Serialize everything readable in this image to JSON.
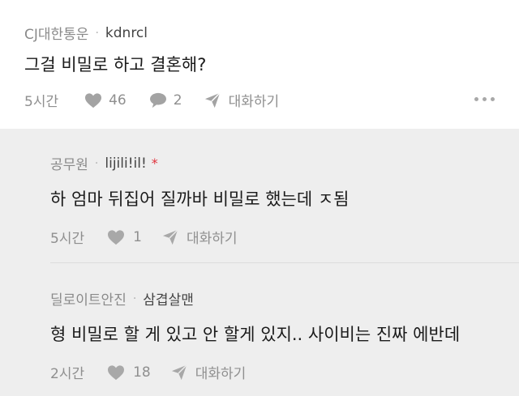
{
  "comment": {
    "brand": "CJ대한통운",
    "nickname": "kdnrcl",
    "text": "그걸 비밀로 하고 결혼해?",
    "time": "5시간",
    "likes": "46",
    "replies": "2",
    "reply_label": "대화하기"
  },
  "replies": [
    {
      "brand": "공무원",
      "nickname": "lijili!il!",
      "star": "*",
      "text": "하 엄마 뒤집어 질까바 비밀로 했는데 ㅈ됨",
      "time": "5시간",
      "likes": "1",
      "reply_label": "대화하기"
    },
    {
      "brand": "딜로이트안진",
      "nickname": "삼겹살맨",
      "text": "형 비밀로 할 게 있고 안 할게 있지.. 사이비는 진짜 에반데",
      "time": "2시간",
      "likes": "18",
      "reply_label": "대화하기"
    }
  ],
  "colors": {
    "reply_bg": "#eeeeee",
    "meta_gray": "#8a8a8a",
    "star_red": "#e0323c"
  }
}
